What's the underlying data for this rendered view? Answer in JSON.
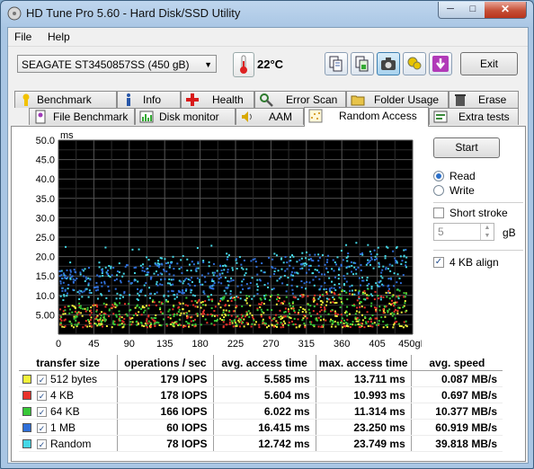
{
  "window": {
    "title": "HD Tune Pro 5.60 - Hard Disk/SSD Utility"
  },
  "menu": {
    "file": "File",
    "help": "Help"
  },
  "toolbar": {
    "drive": "SEAGATE ST3450857SS (450 gB)",
    "temperature": "22°C",
    "exit_label": "Exit"
  },
  "tabs_row1": [
    {
      "label": "Benchmark",
      "icon": "benchmark-icon"
    },
    {
      "label": "Info",
      "icon": "info-icon"
    },
    {
      "label": "Health",
      "icon": "health-icon"
    },
    {
      "label": "Error Scan",
      "icon": "error-scan-icon"
    },
    {
      "label": "Folder Usage",
      "icon": "folder-icon"
    },
    {
      "label": "Erase",
      "icon": "trash-icon"
    }
  ],
  "tabs_row2": [
    {
      "label": "File Benchmark",
      "icon": "file-benchmark-icon"
    },
    {
      "label": "Disk monitor",
      "icon": "disk-monitor-icon"
    },
    {
      "label": "AAM",
      "icon": "speaker-icon"
    },
    {
      "label": "Random Access",
      "icon": "random-access-icon",
      "selected": true
    },
    {
      "label": "Extra tests",
      "icon": "extra-tests-icon"
    }
  ],
  "controls": {
    "start_label": "Start",
    "read_label": "Read",
    "write_label": "Write",
    "mode": "Read",
    "short_stroke_label": "Short stroke",
    "short_stroke_checked": false,
    "short_stroke_value": "5",
    "short_stroke_unit": "gB",
    "align_label": "4 KB align",
    "align_checked": true
  },
  "chart_data": {
    "type": "scatter",
    "ylabel": "ms",
    "xlabel": "",
    "xlim": [
      0,
      450
    ],
    "ylim": [
      0,
      50
    ],
    "x_ticks": [
      "0",
      "45",
      "90",
      "135",
      "180",
      "225",
      "270",
      "315",
      "360",
      "405",
      "450gB"
    ],
    "y_ticks": [
      "5.00",
      "10.0",
      "15.0",
      "20.0",
      "25.0",
      "30.0",
      "35.0",
      "40.0",
      "45.0",
      "50.0"
    ],
    "grid": true,
    "series": [
      {
        "name": "512 bytes",
        "color": "#f2f23a",
        "y_min": 2.0,
        "y_max_start": 7.5,
        "y_max_end": 12.5
      },
      {
        "name": "4 KB",
        "color": "#e8322a",
        "y_min": 2.0,
        "y_max_start": 7.5,
        "y_max_end": 12.0
      },
      {
        "name": "64 KB",
        "color": "#38c838",
        "y_min": 2.5,
        "y_max_start": 8.0,
        "y_max_end": 12.5
      },
      {
        "name": "1 MB",
        "color": "#2f6fd8",
        "y_min": 10.5,
        "y_max_start": 17.0,
        "y_max_end": 22.5
      },
      {
        "name": "Random",
        "color": "#45d7e6",
        "y_min": 9.0,
        "y_max_start": 19.0,
        "y_max_end": 23.5
      }
    ]
  },
  "results": {
    "headers": [
      "transfer size",
      "operations / sec",
      "avg. access time",
      "max. access time",
      "avg. speed"
    ],
    "rows": [
      {
        "size": "512 bytes",
        "color": "#f2f23a",
        "ops": "179 IOPS",
        "avg": "5.585 ms",
        "max": "13.711 ms",
        "speed": "0.087 MB/s"
      },
      {
        "size": "4 KB",
        "color": "#e8322a",
        "ops": "178 IOPS",
        "avg": "5.604 ms",
        "max": "10.993 ms",
        "speed": "0.697 MB/s"
      },
      {
        "size": "64 KB",
        "color": "#38c838",
        "ops": "166 IOPS",
        "avg": "6.022 ms",
        "max": "11.314 ms",
        "speed": "10.377 MB/s"
      },
      {
        "size": "1 MB",
        "color": "#2f6fd8",
        "ops": "60 IOPS",
        "avg": "16.415 ms",
        "max": "23.250 ms",
        "speed": "60.919 MB/s"
      },
      {
        "size": "Random",
        "color": "#45d7e6",
        "ops": "78 IOPS",
        "avg": "12.742 ms",
        "max": "23.749 ms",
        "speed": "39.818 MB/s"
      }
    ]
  }
}
